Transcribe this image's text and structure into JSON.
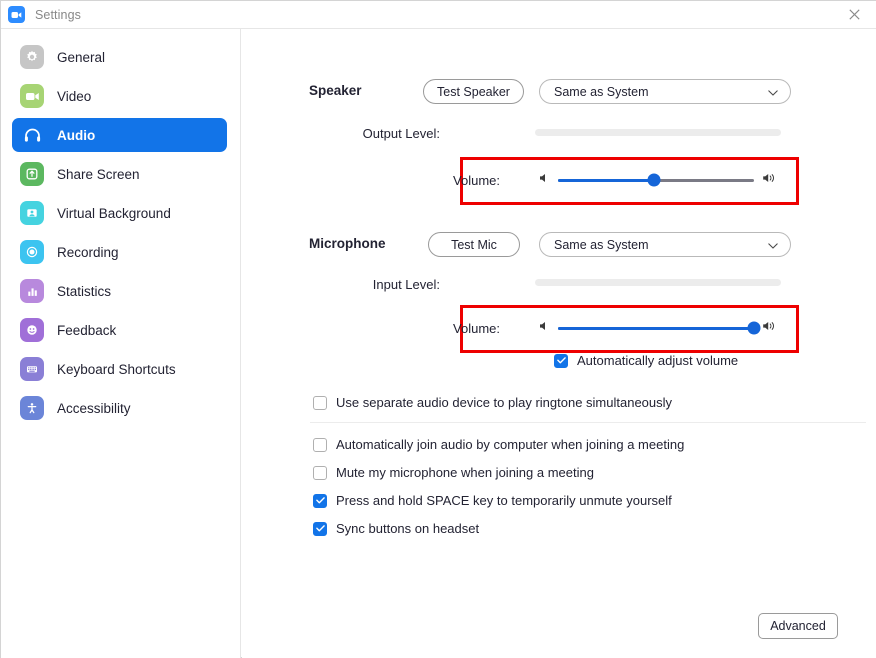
{
  "window": {
    "title": "Settings",
    "logo_icon": "zoom-camera-icon",
    "close_icon": "close-icon"
  },
  "sidebar": {
    "items": [
      {
        "label": "General",
        "icon": "gear-icon",
        "color": "#c6c6c6",
        "active": false
      },
      {
        "label": "Video",
        "icon": "video-camera-icon",
        "color": "#a7d474",
        "active": false
      },
      {
        "label": "Audio",
        "icon": "headphones-icon",
        "color": "#1274e8",
        "active": true
      },
      {
        "label": "Share Screen",
        "icon": "share-screen-icon",
        "color": "#5cb860",
        "active": false
      },
      {
        "label": "Virtual Background",
        "icon": "person-frame-icon",
        "color": "#45d3e0",
        "active": false
      },
      {
        "label": "Recording",
        "icon": "record-circle-icon",
        "color": "#3cc4f0",
        "active": false
      },
      {
        "label": "Statistics",
        "icon": "bar-chart-icon",
        "color": "#b889dd",
        "active": false
      },
      {
        "label": "Feedback",
        "icon": "smiley-face-icon",
        "color": "#a06fd8",
        "active": false
      },
      {
        "label": "Keyboard Shortcuts",
        "icon": "keyboard-icon",
        "color": "#8a7fd6",
        "active": false
      },
      {
        "label": "Accessibility",
        "icon": "accessibility-icon",
        "color": "#6b85d8",
        "active": false
      }
    ]
  },
  "speaker": {
    "section_label": "Speaker",
    "test_button": "Test Speaker",
    "device": "Same as System",
    "output_level_label": "Output Level:",
    "output_level_value": 0,
    "volume_label": "Volume:",
    "volume_value": 49,
    "mute_icon": "speaker-low-icon",
    "loud_icon": "speaker-high-icon",
    "highlighted": true
  },
  "microphone": {
    "section_label": "Microphone",
    "test_button": "Test Mic",
    "device": "Same as System",
    "input_level_label": "Input Level:",
    "input_level_value": 0,
    "volume_label": "Volume:",
    "volume_value": 100,
    "mute_icon": "speaker-low-icon",
    "loud_icon": "speaker-high-icon",
    "highlighted": true,
    "auto_adjust": {
      "label": "Automatically adjust volume",
      "checked": true
    }
  },
  "options": {
    "group_one": [
      {
        "label": "Use separate audio device to play ringtone simultaneously",
        "checked": false
      }
    ],
    "group_two": [
      {
        "label": "Automatically join audio by computer when joining a meeting",
        "checked": false
      },
      {
        "label": "Mute my microphone when joining a meeting",
        "checked": false
      },
      {
        "label": "Press and hold SPACE key to temporarily unmute yourself",
        "checked": true
      },
      {
        "label": "Sync buttons on headset",
        "checked": true
      }
    ]
  },
  "footer": {
    "advanced_button": "Advanced"
  },
  "colors": {
    "accent": "#1274e8",
    "slider_fill": "#1565d8",
    "highlight_box": "#ee0000",
    "track": "#7a7a85",
    "level_bar": "#ececec"
  }
}
